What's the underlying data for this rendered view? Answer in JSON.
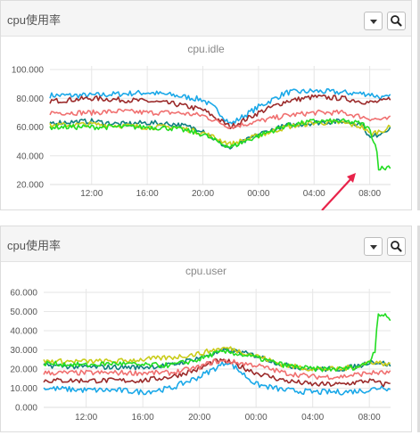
{
  "panels": [
    {
      "title": "cpu使用率",
      "menu_icon": "chevron-down-icon",
      "zoom_icon": "zoom-icon"
    },
    {
      "title": "cpu使用率",
      "menu_icon": "chevron-down-icon",
      "zoom_icon": "zoom-icon"
    }
  ],
  "colors": {
    "s1": "#1aa8e8",
    "s2": "#f07070",
    "s3": "#9b2a2a",
    "s4": "#0f7f7f",
    "s5": "#c9cc1a",
    "s6": "#22dd22",
    "arrow": "#e8234a"
  },
  "chart_data": [
    {
      "type": "line",
      "title": "cpu.idle",
      "xlabel": "",
      "ylabel": "",
      "x_ticks": [
        "12:00",
        "16:00",
        "20:00",
        "00:00",
        "04:00",
        "08:00"
      ],
      "y_ticks": [
        "100.000",
        "80.000",
        "60.000",
        "40.000",
        "20.000"
      ],
      "ylim": [
        20,
        100
      ],
      "x_range_hours": [
        9,
        33.5
      ],
      "grid": true,
      "annotation": "arrow pointing to the drop of the green series near 07:30",
      "series": [
        {
          "color": "#1aa8e8",
          "points": [
            [
              9,
              82
            ],
            [
              12,
              82
            ],
            [
              14,
              83
            ],
            [
              16,
              84
            ],
            [
              18,
              82
            ],
            [
              20,
              79
            ],
            [
              21,
              72
            ],
            [
              22,
              62
            ],
            [
              24,
              74
            ],
            [
              26,
              84
            ],
            [
              28,
              85
            ],
            [
              30,
              84
            ],
            [
              32,
              83
            ],
            [
              33,
              80
            ],
            [
              33.5,
              81
            ]
          ]
        },
        {
          "color": "#9b2a2a",
          "points": [
            [
              9,
              78
            ],
            [
              12,
              80
            ],
            [
              14,
              79
            ],
            [
              16,
              78
            ],
            [
              18,
              76
            ],
            [
              20,
              72
            ],
            [
              21,
              66
            ],
            [
              22,
              60
            ],
            [
              24,
              70
            ],
            [
              26,
              78
            ],
            [
              28,
              81
            ],
            [
              30,
              80
            ],
            [
              32,
              77
            ],
            [
              33,
              78
            ],
            [
              33.5,
              80
            ]
          ]
        },
        {
          "color": "#f07070",
          "points": [
            [
              9,
              70
            ],
            [
              12,
              70
            ],
            [
              14,
              71
            ],
            [
              16,
              70
            ],
            [
              18,
              70
            ],
            [
              20,
              68
            ],
            [
              21,
              64
            ],
            [
              22,
              60
            ],
            [
              24,
              64
            ],
            [
              26,
              68
            ],
            [
              28,
              70
            ],
            [
              30,
              70
            ],
            [
              32,
              66
            ],
            [
              33,
              65
            ],
            [
              33.5,
              66
            ]
          ]
        },
        {
          "color": "#0f7f7f",
          "points": [
            [
              9,
              63
            ],
            [
              12,
              64
            ],
            [
              14,
              62
            ],
            [
              16,
              63
            ],
            [
              18,
              62
            ],
            [
              20,
              58
            ],
            [
              21,
              50
            ],
            [
              22,
              45
            ],
            [
              24,
              55
            ],
            [
              26,
              61
            ],
            [
              28,
              63
            ],
            [
              30,
              64
            ],
            [
              31.5,
              62
            ],
            [
              32,
              52
            ],
            [
              33,
              57
            ],
            [
              33.5,
              60
            ]
          ]
        },
        {
          "color": "#c9cc1a",
          "points": [
            [
              9,
              61
            ],
            [
              12,
              62
            ],
            [
              14,
              61
            ],
            [
              16,
              60
            ],
            [
              18,
              60
            ],
            [
              20,
              56
            ],
            [
              21,
              52
            ],
            [
              22,
              48
            ],
            [
              24,
              54
            ],
            [
              26,
              60
            ],
            [
              28,
              63
            ],
            [
              30,
              63
            ],
            [
              31.5,
              60
            ],
            [
              32,
              55
            ],
            [
              33,
              58
            ],
            [
              33.5,
              60
            ]
          ]
        },
        {
          "color": "#22dd22",
          "points": [
            [
              9,
              60
            ],
            [
              12,
              60
            ],
            [
              14,
              60
            ],
            [
              16,
              60
            ],
            [
              18,
              59
            ],
            [
              20,
              55
            ],
            [
              21,
              50
            ],
            [
              22,
              46
            ],
            [
              24,
              54
            ],
            [
              26,
              61
            ],
            [
              28,
              64
            ],
            [
              30,
              64
            ],
            [
              31,
              63
            ],
            [
              31.5,
              62
            ],
            [
              32,
              58
            ],
            [
              32.5,
              45
            ],
            [
              32.6,
              32
            ],
            [
              33,
              31
            ],
            [
              33.5,
              33
            ]
          ]
        }
      ]
    },
    {
      "type": "line",
      "title": "cpu.user",
      "xlabel": "",
      "ylabel": "",
      "x_ticks": [
        "12:00",
        "16:00",
        "20:00",
        "00:00",
        "04:00",
        "08:00"
      ],
      "y_ticks": [
        "60.000",
        "50.000",
        "40.000",
        "30.000",
        "20.000",
        "10.000",
        "0.000"
      ],
      "ylim": [
        0,
        60
      ],
      "x_range_hours": [
        9,
        33.5
      ],
      "grid": true,
      "series": [
        {
          "color": "#1aa8e8",
          "points": [
            [
              9,
              10
            ],
            [
              12,
              9
            ],
            [
              14,
              9
            ],
            [
              16,
              8
            ],
            [
              18,
              10
            ],
            [
              20,
              16
            ],
            [
              21,
              20
            ],
            [
              22,
              24
            ],
            [
              23,
              18
            ],
            [
              24,
              12
            ],
            [
              26,
              9
            ],
            [
              28,
              8
            ],
            [
              30,
              8
            ],
            [
              32,
              9
            ],
            [
              33,
              11
            ],
            [
              33.5,
              9
            ]
          ]
        },
        {
          "color": "#9b2a2a",
          "points": [
            [
              9,
              14
            ],
            [
              12,
              14
            ],
            [
              14,
              14
            ],
            [
              16,
              14
            ],
            [
              18,
              16
            ],
            [
              20,
              20
            ],
            [
              21,
              24
            ],
            [
              22,
              24
            ],
            [
              24,
              18
            ],
            [
              26,
              14
            ],
            [
              28,
              12
            ],
            [
              30,
              12
            ],
            [
              32,
              14
            ],
            [
              33,
              12
            ],
            [
              33.5,
              13
            ]
          ]
        },
        {
          "color": "#f07070",
          "points": [
            [
              9,
              18
            ],
            [
              12,
              18
            ],
            [
              14,
              18
            ],
            [
              16,
              18
            ],
            [
              18,
              18
            ],
            [
              20,
              21
            ],
            [
              21,
              24
            ],
            [
              22,
              24
            ],
            [
              24,
              22
            ],
            [
              26,
              18
            ],
            [
              28,
              16
            ],
            [
              30,
              16
            ],
            [
              32,
              18
            ],
            [
              33,
              18
            ],
            [
              33.5,
              18
            ]
          ]
        },
        {
          "color": "#0f7f7f",
          "points": [
            [
              9,
              22
            ],
            [
              12,
              21
            ],
            [
              14,
              21
            ],
            [
              16,
              21
            ],
            [
              18,
              22
            ],
            [
              20,
              26
            ],
            [
              21,
              28
            ],
            [
              22,
              30
            ],
            [
              24,
              27
            ],
            [
              26,
              22
            ],
            [
              28,
              20
            ],
            [
              30,
              20
            ],
            [
              31.5,
              22
            ],
            [
              32,
              24
            ],
            [
              33,
              23
            ],
            [
              33.5,
              22
            ]
          ]
        },
        {
          "color": "#c9cc1a",
          "points": [
            [
              9,
              24
            ],
            [
              12,
              24
            ],
            [
              14,
              24
            ],
            [
              16,
              25
            ],
            [
              18,
              26
            ],
            [
              20,
              28
            ],
            [
              21,
              30
            ],
            [
              22,
              31
            ],
            [
              24,
              27
            ],
            [
              26,
              22
            ],
            [
              28,
              20
            ],
            [
              30,
              20
            ],
            [
              31.5,
              22
            ],
            [
              32,
              24
            ],
            [
              33,
              23
            ],
            [
              33.5,
              22
            ]
          ]
        },
        {
          "color": "#22dd22",
          "points": [
            [
              9,
              23
            ],
            [
              12,
              22
            ],
            [
              14,
              23
            ],
            [
              16,
              22
            ],
            [
              18,
              22
            ],
            [
              20,
              25
            ],
            [
              21,
              28
            ],
            [
              22,
              29
            ],
            [
              24,
              26
            ],
            [
              26,
              22
            ],
            [
              28,
              20
            ],
            [
              30,
              20
            ],
            [
              31,
              21
            ],
            [
              31.5,
              22
            ],
            [
              32,
              24
            ],
            [
              32.4,
              30
            ],
            [
              32.6,
              49
            ],
            [
              33,
              48
            ],
            [
              33.5,
              46
            ]
          ]
        }
      ]
    }
  ]
}
